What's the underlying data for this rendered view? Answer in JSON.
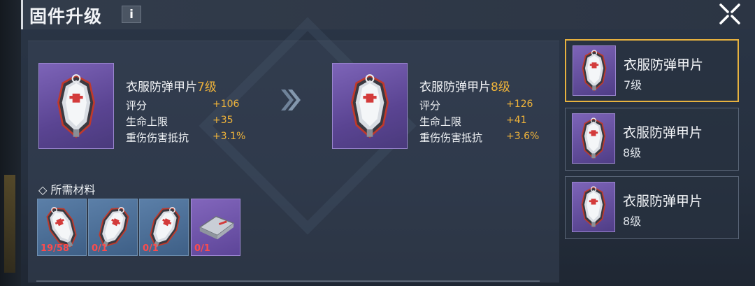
{
  "header": {
    "title": "固件升级",
    "info_label": "i"
  },
  "current_item": {
    "name": "衣服防弹甲片",
    "level": "7级",
    "stats": [
      {
        "label": "评分",
        "value": "+106"
      },
      {
        "label": "生命上限",
        "value": "+35"
      },
      {
        "label": "重伤伤害抵抗",
        "value": "+3.1%"
      }
    ]
  },
  "next_item": {
    "name": "衣服防弹甲片",
    "level": "8级",
    "stats": [
      {
        "label": "评分",
        "value": "+126"
      },
      {
        "label": "生命上限",
        "value": "+41"
      },
      {
        "label": "重伤伤害抵抗",
        "value": "+3.6%"
      }
    ]
  },
  "materials": {
    "title": "◇ 所需材料",
    "slots": [
      {
        "count": "19/58",
        "icon": "armor-plate-icon"
      },
      {
        "count": "0/1",
        "icon": "armor-plate-icon"
      },
      {
        "count": "0/1",
        "icon": "armor-plate-icon"
      },
      {
        "count": "0/1",
        "icon": "metal-plate-icon"
      }
    ]
  },
  "side_list": [
    {
      "name": "衣服防弹甲片",
      "level": "7级",
      "selected": true
    },
    {
      "name": "衣服防弹甲片",
      "level": "8级",
      "selected": false
    },
    {
      "name": "衣服防弹甲片",
      "level": "8级",
      "selected": false
    }
  ],
  "colors": {
    "accent": "#f0b43a",
    "selected_border": "#e7b23f",
    "missing": "#ff4b4b"
  }
}
